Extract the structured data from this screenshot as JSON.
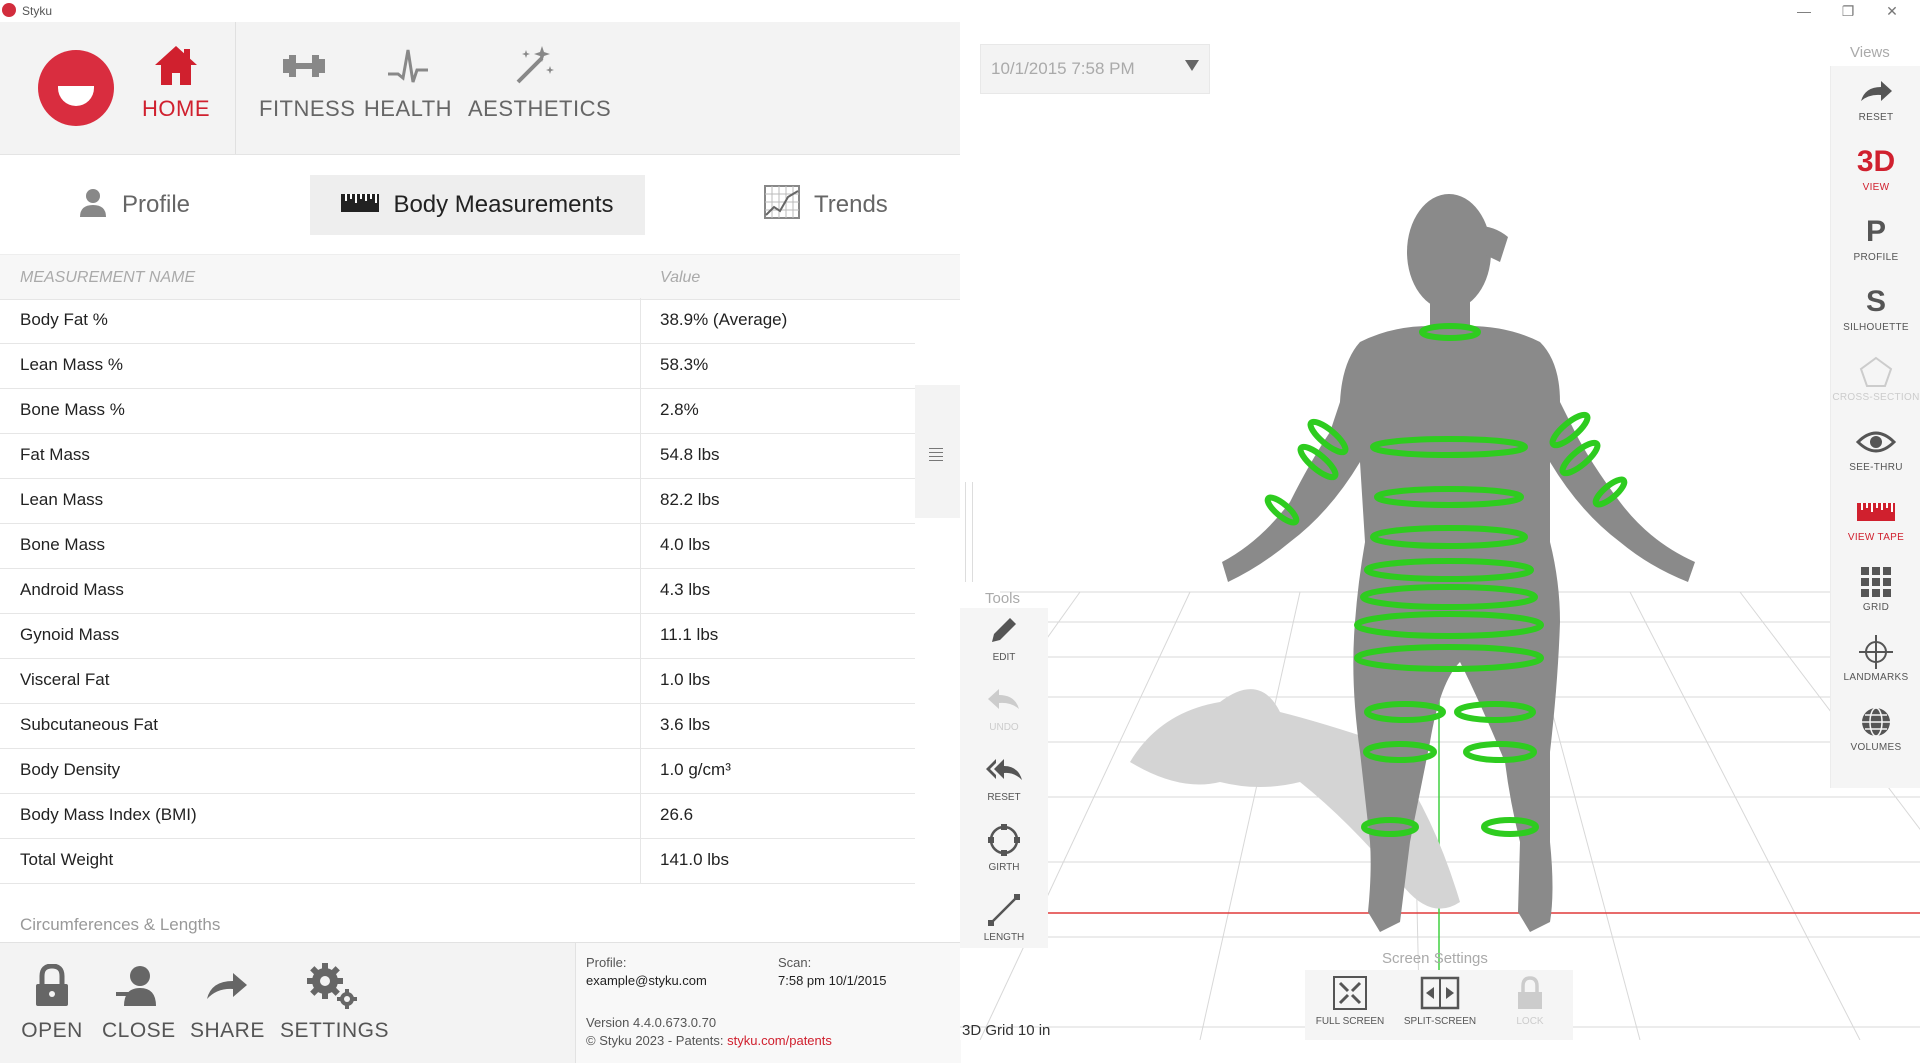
{
  "window": {
    "title": "Styku",
    "min": "—",
    "max": "❐",
    "close": "✕"
  },
  "nav": {
    "home": "HOME",
    "fitness": "FITNESS",
    "health": "HEALTH",
    "aesthetics": "AESTHETICS"
  },
  "subtabs": {
    "profile": "Profile",
    "body_measurements": "Body Measurements",
    "trends": "Trends"
  },
  "table": {
    "header_name": "MEASUREMENT NAME",
    "header_value": "Value",
    "rows": [
      {
        "name": "Body Fat %",
        "value": "38.9% (Average)"
      },
      {
        "name": "Lean Mass %",
        "value": "58.3%"
      },
      {
        "name": "Bone Mass %",
        "value": "2.8%"
      },
      {
        "name": "Fat Mass",
        "value": "54.8 lbs"
      },
      {
        "name": "Lean Mass",
        "value": "82.2 lbs"
      },
      {
        "name": "Bone Mass",
        "value": "4.0 lbs"
      },
      {
        "name": "Android Mass",
        "value": "4.3 lbs"
      },
      {
        "name": "Gynoid Mass",
        "value": "11.1 lbs"
      },
      {
        "name": "Visceral Fat",
        "value": "1.0 lbs"
      },
      {
        "name": "Subcutaneous Fat",
        "value": "3.6 lbs"
      },
      {
        "name": "Body Density",
        "value": "1.0 g/cm³"
      },
      {
        "name": "Body Mass Index (BMI)",
        "value": "26.6"
      },
      {
        "name": "Total Weight",
        "value": "141.0 lbs"
      }
    ],
    "section_label": "Circumferences & Lengths"
  },
  "bottom": {
    "open": "OPEN",
    "close": "CLOSE",
    "share": "SHARE",
    "settings": "SETTINGS"
  },
  "info": {
    "profile_label": "Profile:",
    "profile_value": "example@styku.com",
    "scan_label": "Scan:",
    "scan_value": "7:58 pm 10/1/2015",
    "version": "Version 4.4.0.673.0.70",
    "copyright": "© Styku 2023 - Patents: ",
    "patents_link": "styku.com/patents"
  },
  "viewer": {
    "scan_date": "10/1/2015 7:58 PM",
    "views_title": "Views",
    "views": {
      "reset": "RESET",
      "view3d_glyph": "3D",
      "view3d": "VIEW",
      "profile_glyph": "P",
      "profile": "PROFILE",
      "silhouette_glyph": "S",
      "silhouette": "SILHOUETTE",
      "cross_section": "CROSS-SECTION",
      "see_thru": "SEE-THRU",
      "view_tape": "VIEW TAPE",
      "grid": "GRID",
      "landmarks": "LANDMARKS",
      "volumes": "VOLUMES"
    },
    "tools_title": "Tools",
    "tools": {
      "edit": "EDIT",
      "undo": "UNDO",
      "reset": "RESET",
      "girth": "GIRTH",
      "length": "LENGTH"
    },
    "screen_title": "Screen Settings",
    "screen": {
      "full_screen": "FULL SCREEN",
      "split_screen": "SPLIT-SCREEN",
      "lock": "LOCK"
    },
    "grid_label": "3D Grid 10 in"
  },
  "colors": {
    "accent": "#d0202e",
    "girth": "#2ecc1f",
    "body": "#8a8a8a"
  }
}
